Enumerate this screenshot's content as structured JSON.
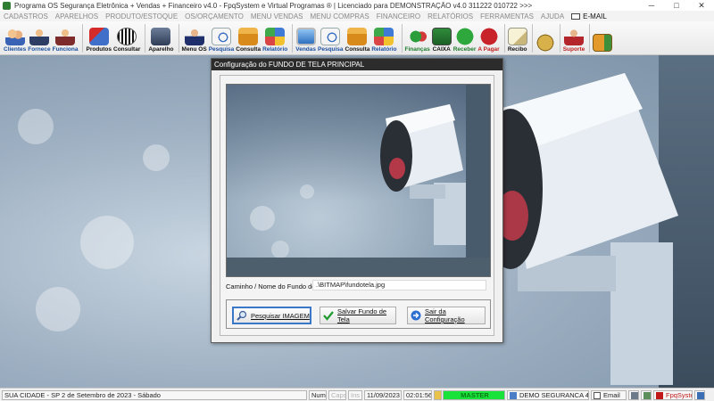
{
  "window": {
    "title": "Programa OS Segurança Eletrônica + Vendas + Financeiro v4.0 - FpqSystem e Virtual Programas ® | Licenciado para  DEMONSTRAÇÃO v4.0 311222 010722 >>>",
    "controls": {
      "minimize": "─",
      "maximize": "□",
      "close": "✕"
    }
  },
  "menu": {
    "items": [
      "CADASTROS",
      "APARELHOS",
      "PRODUTO/ESTOQUE",
      "OS/ORÇAMENTO",
      "MENU VENDAS",
      "MENU COMPRAS",
      "FINANCEIRO",
      "RELATÓRIOS",
      "FERRAMENTAS",
      "AJUDA"
    ],
    "email": "E-MAIL"
  },
  "toolbar": {
    "clientes": "Clientes",
    "fornece": "Fornece",
    "funciona": "Funciona",
    "produtos": "Produtos",
    "consultar": "Consultar",
    "aparelho": "Aparelho",
    "menu_os": "Menu OS",
    "pesquisa1": "Pesquisa",
    "consulta1": "Consulta",
    "relatorio1": "Relatório",
    "vendas": "Vendas",
    "pesquisa2": "Pesquisa",
    "consulta2": "Consulta",
    "relatorio2": "Relatório",
    "financas": "Finanças",
    "caixa": "CAIXA",
    "receber": "Receber",
    "a_pagar": "A Pagar",
    "recibo": "Recibo",
    "suporte": "Suporte"
  },
  "dialog": {
    "title": "Configuração do FUNDO DE TELA PRINCIPAL",
    "path_label": "Caminho / Nome do Fundo de Tela",
    "path_value": ".\\BITMAP\\fundotela.jpg",
    "btn_search": "Pesquisar IMAGEM",
    "btn_save": "Salvar Fundo de Tela",
    "btn_exit": "Sair da Configuração"
  },
  "status": {
    "city": "SUA CIDADE - SP  2 de Setembro de 2023 - Sábado",
    "num": "Num",
    "caps": "Caps",
    "ins": "Ins",
    "date": "11/09/2023",
    "time": "02:01:56",
    "master": "MASTER",
    "company": "DEMO SEGURANCA 4.0",
    "email": "Email",
    "brand": "FpqSystem"
  },
  "colors": {
    "accent": "#3a77c8",
    "status_green": "#19e23b",
    "brand_red": "#c01818"
  }
}
